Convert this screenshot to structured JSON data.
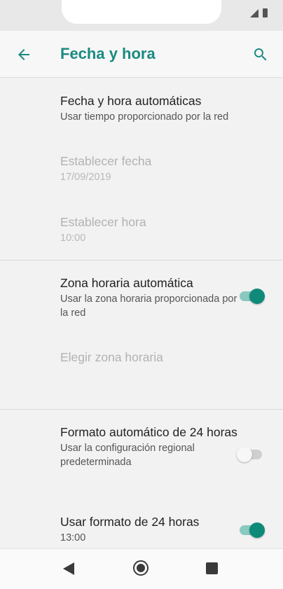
{
  "app_bar": {
    "title": "Fecha y hora",
    "back_icon": "arrow-back-icon",
    "search_icon": "search-icon",
    "accent_color": "#1a8a80"
  },
  "settings": {
    "auto_datetime": {
      "title": "Fecha y hora automáticas",
      "subtitle": "Usar tiempo proporcionado por la red"
    },
    "set_date": {
      "title": "Establecer fecha",
      "value": "17/09/2019"
    },
    "set_time": {
      "title": "Establecer hora",
      "value": "10:00"
    },
    "auto_timezone": {
      "title": "Zona horaria automática",
      "subtitle": "Usar la zona horaria proporcionada por la red",
      "enabled": true
    },
    "choose_timezone": {
      "title": "Elegir zona horaria"
    },
    "auto_24h": {
      "title": "Formato automático de 24 horas",
      "subtitle": "Usar la configuración regional predeterminada",
      "enabled": false
    },
    "use_24h": {
      "title": "Usar formato de 24 horas",
      "value": "13:00",
      "enabled": true
    }
  },
  "nav": {
    "back_icon": "triangle-back-icon",
    "home_icon": "circle-home-icon",
    "recents_icon": "square-recents-icon"
  },
  "colors": {
    "toggle_on": "#0f8a78",
    "toggle_on_track": "#8ac9c1"
  }
}
